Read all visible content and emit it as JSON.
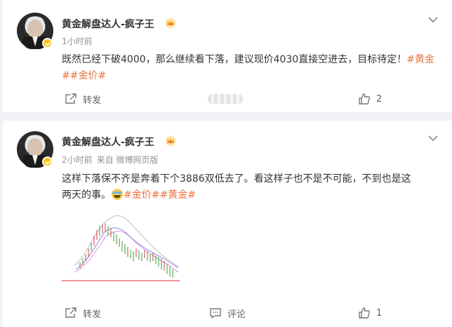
{
  "posts": [
    {
      "author": "黄金解盘达人-疯子王",
      "time": "1小时前",
      "source": "",
      "text": "既然已经下破4000，那么继续看下落，建议现价4030直接空进去，目标待定！",
      "tags": [
        "#黄金#",
        "#金价#"
      ],
      "repost_label": "转发",
      "comment_label": "",
      "like_count": "2"
    },
    {
      "author": "黄金解盘达人-疯子王",
      "time": "2小时前",
      "source": "来自 微博网页版",
      "text_line1": "这样下落保不齐是奔着下个3886双低去了。看这样子也不是不可能，不到也是这",
      "text_line2": "两天的事。",
      "tags": [
        "#金价#",
        "#黄金#"
      ],
      "repost_label": "转发",
      "comment_label": "评论",
      "like_count": "1"
    }
  ],
  "icons": {
    "more": "chevron-down-icon",
    "crown": "crown-badge-icon",
    "verified": "verified-badge-icon",
    "repost": "share-icon",
    "comment": "comment-icon",
    "like": "thumbs-up-icon",
    "emoji": "laugh-cry-emoji"
  },
  "colors": {
    "tag": "#eb7340",
    "verified": "#ffc107",
    "background": "#f1f2f5"
  }
}
